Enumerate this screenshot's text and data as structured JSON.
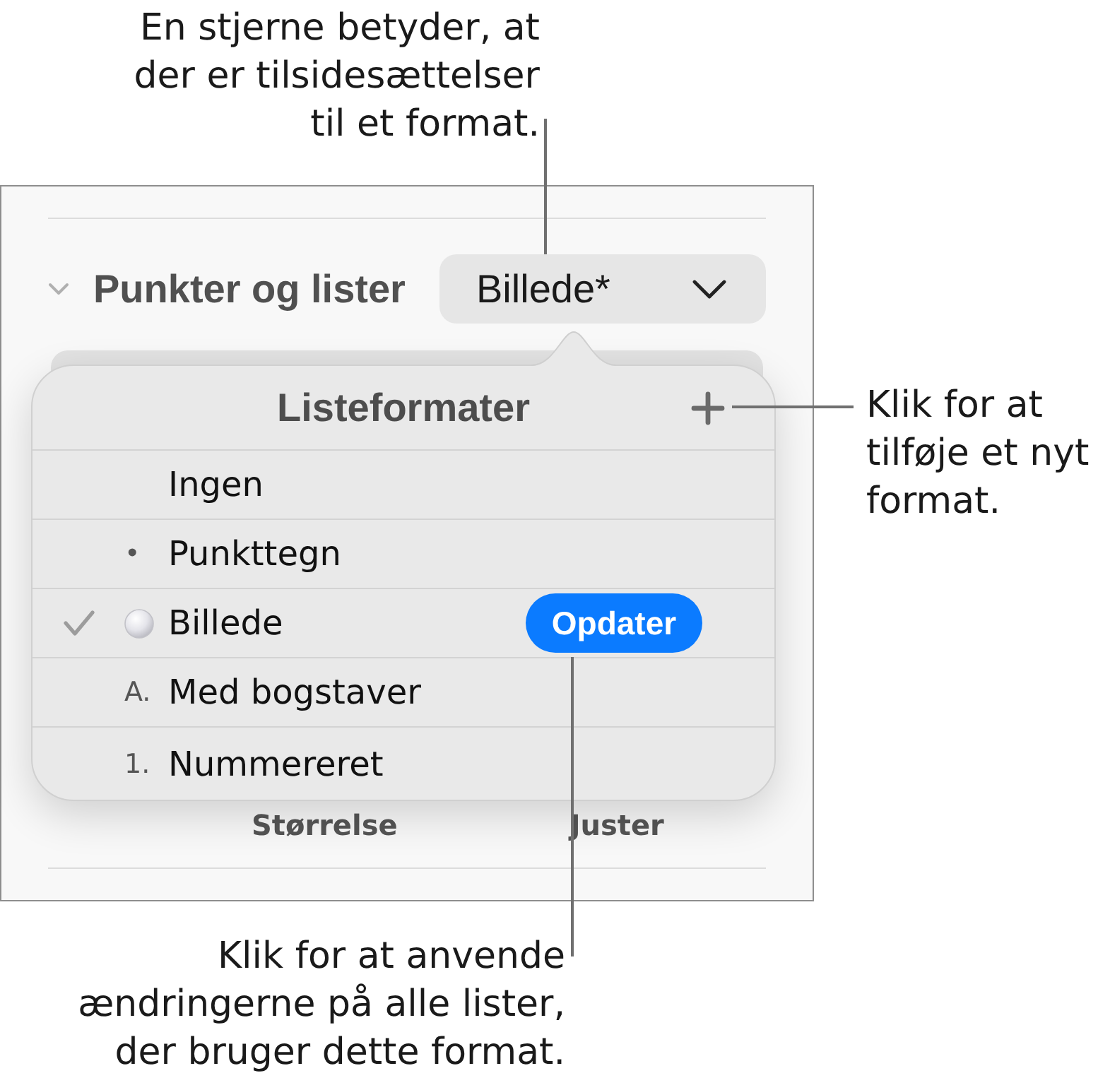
{
  "callouts": [
    {
      "kind": "top",
      "text": "En stjerne betyder, at\nder er tilsidesættelser\ntil et format."
    },
    {
      "kind": "right",
      "text": "Klik for at\ntilføje et nyt\nformat."
    },
    {
      "kind": "bottom",
      "text": "Klik for at anvende\nændringerne på alle lister,\nder bruger dette format."
    }
  ],
  "panel": {
    "section": {
      "title": "Punkter og lister",
      "expanded": true
    },
    "style_popup": {
      "value": "Billede*"
    },
    "footer_labels": [
      "Størrelse",
      "Juster"
    ]
  },
  "popover": {
    "title": "Listeformater",
    "items": [
      {
        "kind": "plain",
        "label": "Ingen",
        "selected": false
      },
      {
        "kind": "glyph",
        "marker": "•",
        "label": "Punkttegn",
        "selected": false
      },
      {
        "kind": "image",
        "label": "Billede",
        "selected": true,
        "action": "Opdater"
      },
      {
        "kind": "glyph",
        "marker": "A.",
        "label": "Med bogstaver",
        "selected": false
      },
      {
        "kind": "glyph",
        "marker": "1.",
        "label": "Nummereret",
        "selected": false
      }
    ]
  }
}
